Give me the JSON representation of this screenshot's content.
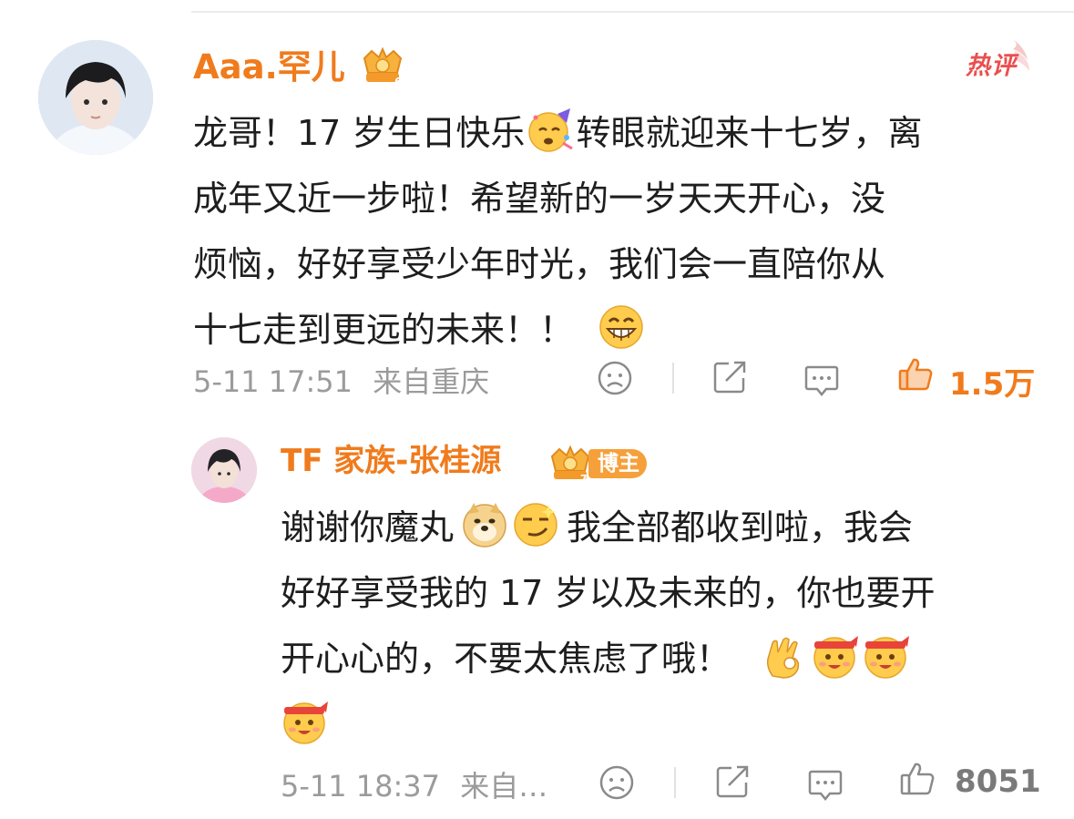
{
  "comment": {
    "username": "Aaa.罕儿",
    "hot_label": "热评",
    "text": {
      "line1_a": "龙哥！17 岁生日快乐",
      "line1_b": "转眼就迎来十七岁，离",
      "line2": "成年又近一步啦！希望新的一岁天天开心，没",
      "line3": "烦恼，好好享受少年时光，我们会一直陪你从",
      "line4": "十七走到更远的未来！！"
    },
    "timestamp": "5-11 17:51",
    "location": "来自重庆",
    "like_count": "1.5万",
    "like_color": "#f07b1c"
  },
  "reply": {
    "username": "TF 家族-张桂源",
    "badge_label": "博主",
    "text": {
      "line1_a": "谢谢你魔丸",
      "line1_b": "我全部都收到啦，我会",
      "line2": "好好享受我的 17 岁以及未来的，你也要开",
      "line3": "开心心的，不要太焦虑了哦！"
    },
    "timestamp": "5-11 18:37",
    "location": "来自…",
    "like_count": "8051",
    "like_color": "#7a7a7a"
  },
  "icons": {
    "emojis_comment": [
      "party-face-emoji",
      "grin-emoji"
    ],
    "emojis_reply": [
      "doge-emoji",
      "smirk-emoji",
      "ok-hand-emoji",
      "cheer-emoji",
      "cheer-emoji",
      "cheer-emoji"
    ],
    "actions": [
      "dislike-icon",
      "share-icon",
      "reply-icon",
      "like-icon"
    ]
  }
}
